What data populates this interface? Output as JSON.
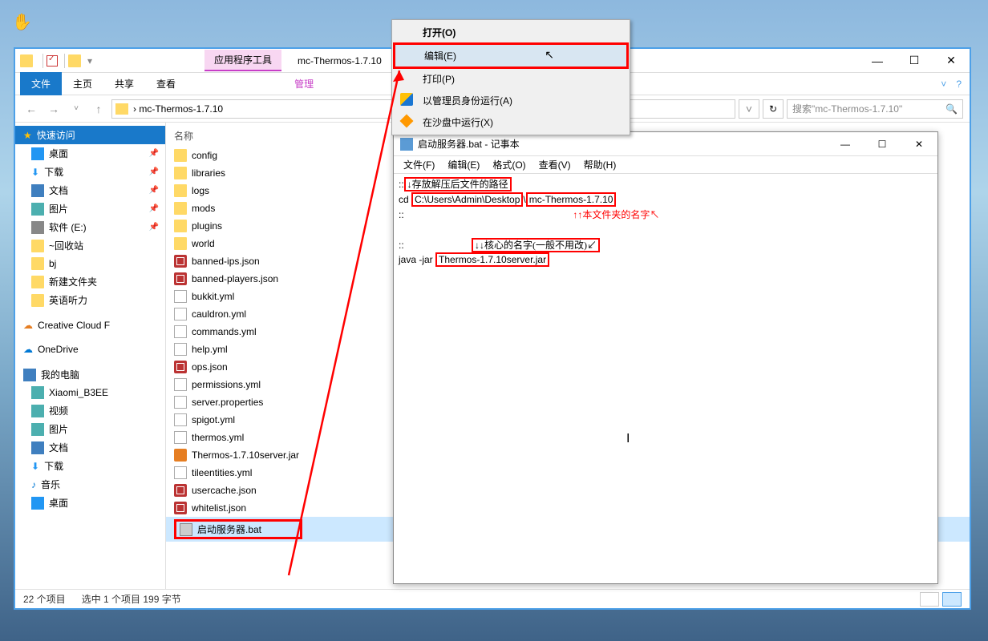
{
  "cursor": "✋",
  "explorer": {
    "app_tools": "应用程序工具",
    "title": "mc-Thermos-1.7.10",
    "win": {
      "min": "—",
      "max": "☐",
      "close": "✕"
    },
    "ribbon": {
      "file": "文件",
      "home": "主页",
      "share": "共享",
      "view": "查看",
      "manage": "管理",
      "chev": "˅",
      "help": "?"
    },
    "addr": {
      "back": "←",
      "fwd": "→",
      "recent": "˅",
      "up": "↑",
      "sep": "›",
      "path": "mc-Thermos-1.7.10",
      "refresh": "↻",
      "search_ph": "搜索\"mc-Thermos-1.7.10\"",
      "search_ic": "🔍"
    },
    "sidebar": {
      "quick": "快速访问",
      "items1": [
        "桌面",
        "下载",
        "文档",
        "图片",
        "软件 (E:)",
        "~回收站",
        "bj",
        "新建文件夹",
        "英语听力"
      ],
      "ccf": "Creative Cloud F",
      "onedrive": "OneDrive",
      "thispc": "我的电脑",
      "items2": [
        "Xiaomi_B3EE",
        "视频",
        "图片",
        "文档",
        "下载",
        "音乐",
        "桌面"
      ]
    },
    "cols": {
      "name": "名称"
    },
    "files": [
      {
        "n": "config",
        "t": "folder"
      },
      {
        "n": "libraries",
        "t": "folder"
      },
      {
        "n": "logs",
        "t": "folder"
      },
      {
        "n": "mods",
        "t": "folder"
      },
      {
        "n": "plugins",
        "t": "folder"
      },
      {
        "n": "world",
        "t": "folder"
      },
      {
        "n": "banned-ips.json",
        "t": "json"
      },
      {
        "n": "banned-players.json",
        "t": "json"
      },
      {
        "n": "bukkit.yml",
        "t": "yml"
      },
      {
        "n": "cauldron.yml",
        "t": "yml"
      },
      {
        "n": "commands.yml",
        "t": "yml"
      },
      {
        "n": "help.yml",
        "t": "yml"
      },
      {
        "n": "ops.json",
        "t": "json"
      },
      {
        "n": "permissions.yml",
        "t": "yml"
      },
      {
        "n": "server.properties",
        "t": "txt"
      },
      {
        "n": "spigot.yml",
        "t": "yml"
      },
      {
        "n": "thermos.yml",
        "t": "yml"
      },
      {
        "n": "Thermos-1.7.10server.jar",
        "t": "jar"
      },
      {
        "n": "tileentities.yml",
        "t": "yml"
      },
      {
        "n": "usercache.json",
        "t": "json"
      },
      {
        "n": "whitelist.json",
        "t": "json"
      },
      {
        "n": "启动服务器.bat",
        "t": "bat",
        "sel": true
      }
    ],
    "status": {
      "count": "22 个项目",
      "sel": "选中 1 个项目  199 字节"
    }
  },
  "ctx": {
    "open": "打开(O)",
    "edit": "编辑(E)",
    "print": "打印(P)",
    "admin": "以管理员身份运行(A)",
    "sand": "在沙盘中运行(X)"
  },
  "notepad": {
    "title": "启动服务器.bat - 记事本",
    "win": {
      "min": "—",
      "max": "☐",
      "close": "✕"
    },
    "menu": [
      "文件(F)",
      "编辑(E)",
      "格式(O)",
      "查看(V)",
      "帮助(H)"
    ],
    "l1a": "::",
    "l1b": "↓存放解压后文件的路径",
    "l2a": "cd ",
    "l2b": "C:\\Users\\Admin\\Desktop",
    "l2c": "\\",
    "l2d": "mc-Thermos-1.7.10",
    "l3": "::",
    "l3ann": "↑↑本文件夹的名字↖",
    "l4": "::",
    "l4ann": "↓↓核心的名字(一般不用改)↙",
    "l5a": "java -jar ",
    "l5b": "Thermos-1.7.10server.jar"
  }
}
